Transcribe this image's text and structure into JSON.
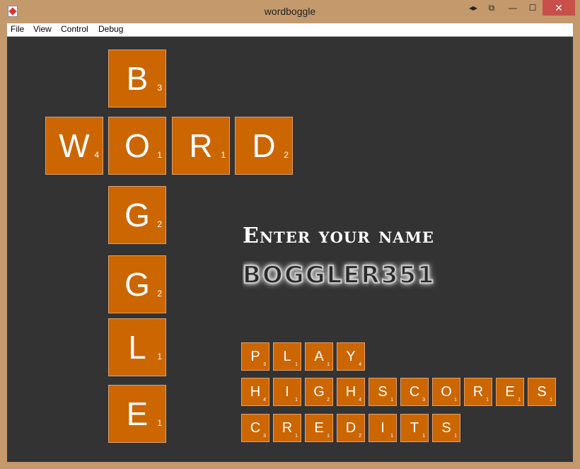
{
  "window": {
    "title": "wordboggle",
    "controls": {
      "nav": "◂▸",
      "restore": "⧉",
      "minimize": "—",
      "maximize": "☐",
      "close": "✕"
    }
  },
  "menubar": {
    "items": [
      "File",
      "View",
      "Control",
      "Debug"
    ]
  },
  "logo": {
    "tiles": [
      {
        "letter": "B",
        "score": "3"
      },
      {
        "letter": "W",
        "score": "4"
      },
      {
        "letter": "O",
        "score": "1"
      },
      {
        "letter": "R",
        "score": "1"
      },
      {
        "letter": "D",
        "score": "2"
      },
      {
        "letter": "G",
        "score": "2"
      },
      {
        "letter": "G",
        "score": "2"
      },
      {
        "letter": "L",
        "score": "1"
      },
      {
        "letter": "E",
        "score": "1"
      }
    ]
  },
  "name_entry": {
    "prompt": "Enter your name",
    "value": "BOGGLER351"
  },
  "menu": {
    "play": [
      {
        "letter": "P",
        "score": "3"
      },
      {
        "letter": "L",
        "score": "1"
      },
      {
        "letter": "A",
        "score": "1"
      },
      {
        "letter": "Y",
        "score": "4"
      }
    ],
    "highscores": [
      {
        "letter": "H",
        "score": "4"
      },
      {
        "letter": "I",
        "score": "1"
      },
      {
        "letter": "G",
        "score": "2"
      },
      {
        "letter": "H",
        "score": "4"
      },
      {
        "letter": "S",
        "score": "1"
      },
      {
        "letter": "C",
        "score": "3"
      },
      {
        "letter": "O",
        "score": "1"
      },
      {
        "letter": "R",
        "score": "1"
      },
      {
        "letter": "E",
        "score": "1"
      },
      {
        "letter": "S",
        "score": "1"
      }
    ],
    "credits": [
      {
        "letter": "C",
        "score": "3"
      },
      {
        "letter": "R",
        "score": "1"
      },
      {
        "letter": "E",
        "score": "1"
      },
      {
        "letter": "D",
        "score": "2"
      },
      {
        "letter": "I",
        "score": "1"
      },
      {
        "letter": "T",
        "score": "1"
      },
      {
        "letter": "S",
        "score": "1"
      }
    ]
  },
  "colors": {
    "tile": "#cc6600",
    "board": "#333333",
    "frame": "#c49a6c"
  }
}
